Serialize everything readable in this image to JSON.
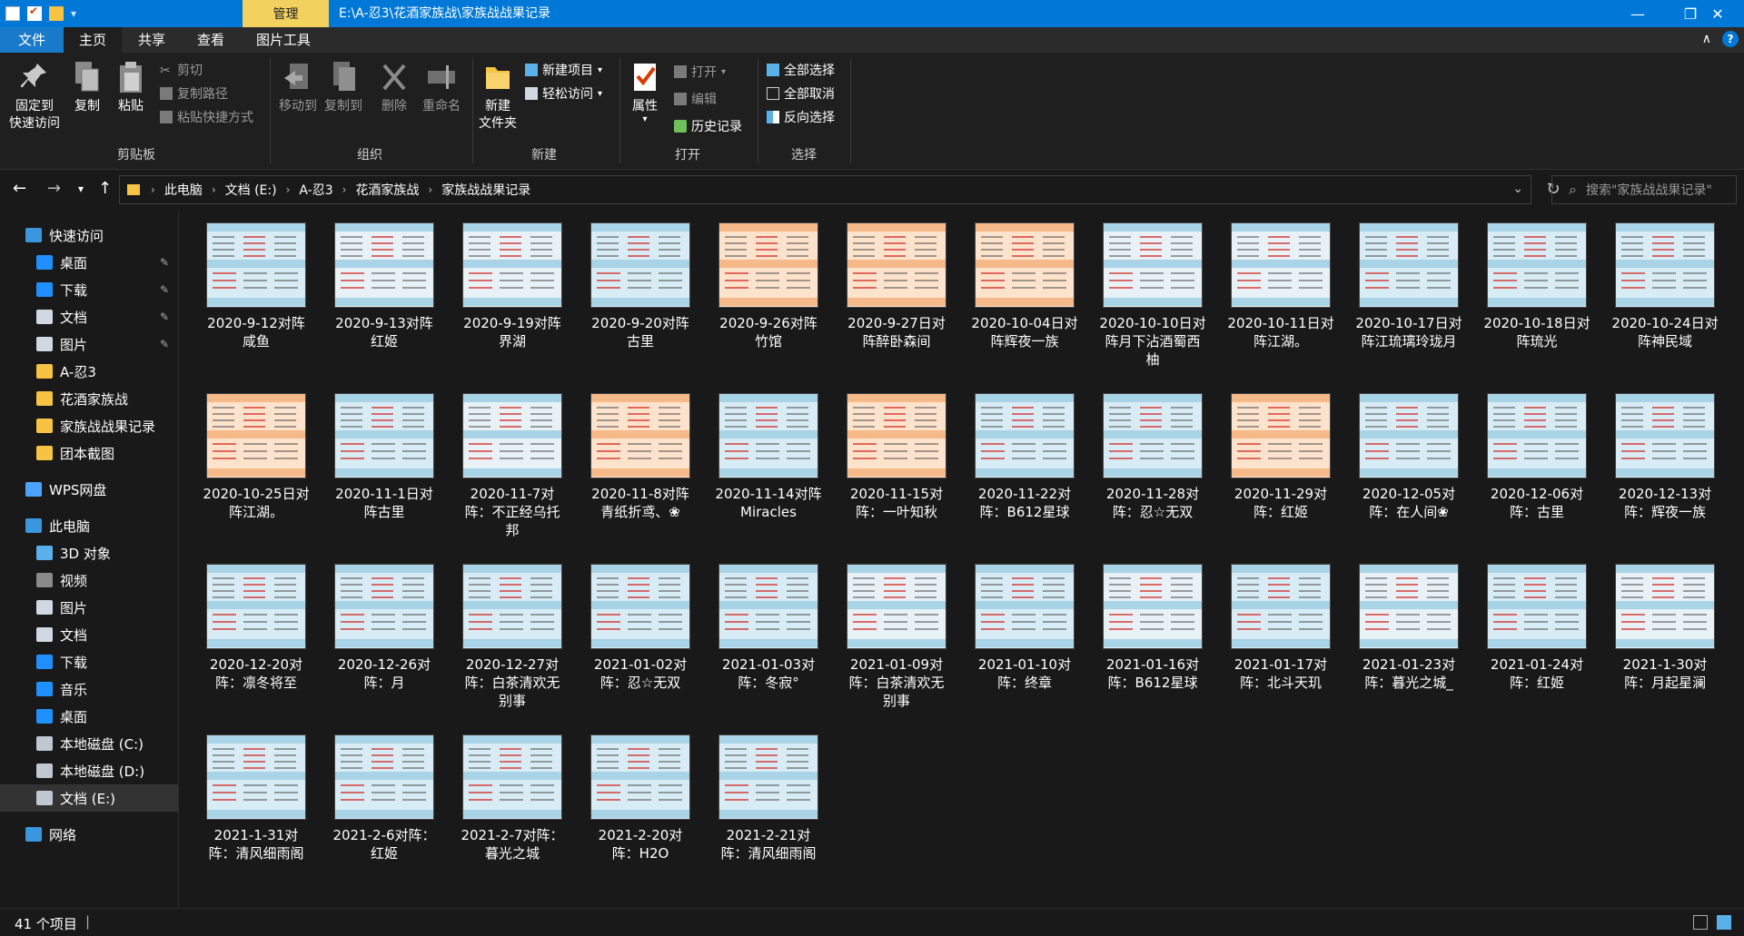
{
  "window": {
    "title": "E:\\A-忍3\\花酒家族战\\家族战战果记录",
    "context_tab": "管理",
    "minimize": "—",
    "restore": "❐",
    "close": "✕"
  },
  "tabs": [
    {
      "label": "文件"
    },
    {
      "label": "主页"
    },
    {
      "label": "共享"
    },
    {
      "label": "查看"
    },
    {
      "label": "图片工具"
    }
  ],
  "ribbon": {
    "clipboard": {
      "group": "剪贴板",
      "pin_l1": "固定到",
      "pin_l2": "快速访问",
      "copy": "复制",
      "paste": "粘贴",
      "cut": "剪切",
      "copy_path": "复制路径",
      "paste_shortcut": "粘贴快捷方式"
    },
    "organize": {
      "group": "组织",
      "move_to": "移动到",
      "copy_to": "复制到",
      "delete": "删除",
      "rename": "重命名"
    },
    "new": {
      "group": "新建",
      "new_folder_l1": "新建",
      "new_folder_l2": "文件夹",
      "new_item": "新建项目",
      "easy_access": "轻松访问"
    },
    "open": {
      "group": "打开",
      "properties": "属性",
      "open": "打开",
      "edit": "编辑",
      "history": "历史记录"
    },
    "select": {
      "group": "选择",
      "select_all": "全部选择",
      "select_none": "全部取消",
      "invert": "反向选择"
    }
  },
  "address": {
    "crumbs": [
      "此电脑",
      "文档 (E:)",
      "A-忍3",
      "花酒家族战",
      "家族战战果记录"
    ],
    "search_placeholder": "搜索\"家族战战果记录\""
  },
  "sidebar": [
    {
      "label": "快速访问",
      "icon": "star-icon",
      "color": "#3a96dd",
      "pinned": false,
      "indent": 0
    },
    {
      "label": "桌面",
      "icon": "desktop-icon",
      "color": "#1e90ff",
      "pinned": true,
      "indent": 1
    },
    {
      "label": "下载",
      "icon": "download-icon",
      "color": "#1e90ff",
      "pinned": true,
      "indent": 1
    },
    {
      "label": "文档",
      "icon": "document-icon",
      "color": "#cfd8e3",
      "pinned": true,
      "indent": 1
    },
    {
      "label": "图片",
      "icon": "pictures-icon",
      "color": "#cfd8e3",
      "pinned": true,
      "indent": 1
    },
    {
      "label": "A-忍3",
      "icon": "folder-icon",
      "color": "#f6c342",
      "pinned": false,
      "indent": 1
    },
    {
      "label": "花酒家族战",
      "icon": "folder-icon",
      "color": "#f6c342",
      "pinned": false,
      "indent": 1
    },
    {
      "label": "家族战战果记录",
      "icon": "folder-icon",
      "color": "#f6c342",
      "pinned": false,
      "indent": 1
    },
    {
      "label": "团本截图",
      "icon": "folder-icon",
      "color": "#f6c342",
      "pinned": false,
      "indent": 1
    },
    {
      "label": "WPS网盘",
      "icon": "cloud-icon",
      "color": "#4aa3ff",
      "pinned": false,
      "indent": 0
    },
    {
      "label": "此电脑",
      "icon": "computer-icon",
      "color": "#3a96dd",
      "pinned": false,
      "indent": 0
    },
    {
      "label": "3D 对象",
      "icon": "3d-objects-icon",
      "color": "#5ab0e8",
      "pinned": false,
      "indent": 1
    },
    {
      "label": "视频",
      "icon": "video-icon",
      "color": "#8a8a8a",
      "pinned": false,
      "indent": 1
    },
    {
      "label": "图片",
      "icon": "pictures-icon",
      "color": "#cfd8e3",
      "pinned": false,
      "indent": 1
    },
    {
      "label": "文档",
      "icon": "document-icon",
      "color": "#cfd8e3",
      "pinned": false,
      "indent": 1
    },
    {
      "label": "下载",
      "icon": "download-icon",
      "color": "#1e90ff",
      "pinned": false,
      "indent": 1
    },
    {
      "label": "音乐",
      "icon": "music-icon",
      "color": "#1e90ff",
      "pinned": false,
      "indent": 1
    },
    {
      "label": "桌面",
      "icon": "desktop-icon",
      "color": "#1e90ff",
      "pinned": false,
      "indent": 1
    },
    {
      "label": "本地磁盘 (C:)",
      "icon": "drive-c-icon",
      "color": "#bfc7d0",
      "pinned": false,
      "indent": 1
    },
    {
      "label": "本地磁盘 (D:)",
      "icon": "drive-icon",
      "color": "#bfc7d0",
      "pinned": false,
      "indent": 1
    },
    {
      "label": "文档 (E:)",
      "icon": "drive-icon",
      "color": "#bfc7d0",
      "pinned": false,
      "indent": 1,
      "selected": true
    },
    {
      "label": "网络",
      "icon": "network-icon",
      "color": "#3a96dd",
      "pinned": false,
      "indent": 0
    }
  ],
  "files": [
    {
      "line1": "2020-9-12对阵",
      "line2": "咸鱼",
      "tone": "blue"
    },
    {
      "line1": "2020-9-13对阵",
      "line2": "红姬",
      "tone": "white"
    },
    {
      "line1": "2020-9-19对阵",
      "line2": "界湖",
      "tone": "white"
    },
    {
      "line1": "2020-9-20对阵",
      "line2": "古里",
      "tone": "blue"
    },
    {
      "line1": "2020-9-26对阵",
      "line2": "竹馆",
      "tone": "orange"
    },
    {
      "line1": "2020-9-27日对",
      "line2": "阵醉卧森间",
      "tone": "orange"
    },
    {
      "line1": "2020-10-04日对",
      "line2": "阵辉夜一族",
      "tone": "orange"
    },
    {
      "line1": "2020-10-10日对",
      "line2": "阵月下沾酒蜀西",
      "line3": "柚",
      "tone": "white"
    },
    {
      "line1": "2020-10-11日对",
      "line2": "阵江湖。",
      "tone": "white"
    },
    {
      "line1": "2020-10-17日对",
      "line2": "阵江琉璃玲珑月",
      "tone": "blue"
    },
    {
      "line1": "2020-10-18日对",
      "line2": "阵琉光",
      "tone": "blue"
    },
    {
      "line1": "2020-10-24日对",
      "line2": "阵神民域",
      "tone": "blue"
    },
    {
      "line1": "2020-10-25日对",
      "line2": "阵江湖。",
      "tone": "orange"
    },
    {
      "line1": "2020-11-1日对",
      "line2": "阵古里",
      "tone": "blue"
    },
    {
      "line1": "2020-11-7对",
      "line2": "阵：不正经乌托",
      "line3": "邦",
      "tone": "white"
    },
    {
      "line1": "2020-11-8对阵",
      "line2": "青纸折鸢、❀",
      "tone": "orange"
    },
    {
      "line1": "2020-11-14对阵",
      "line2": "Miracles",
      "tone": "blue"
    },
    {
      "line1": "2020-11-15对",
      "line2": "阵：一叶知秋",
      "tone": "orange"
    },
    {
      "line1": "2020-11-22对",
      "line2": "阵：B612星球",
      "tone": "blue"
    },
    {
      "line1": "2020-11-28对",
      "line2": "阵：忍☆无双",
      "tone": "blue"
    },
    {
      "line1": "2020-11-29对",
      "line2": "阵：红姬",
      "tone": "orange"
    },
    {
      "line1": "2020-12-05对",
      "line2": "阵：在人间❀",
      "tone": "blue"
    },
    {
      "line1": "2020-12-06对",
      "line2": "阵：古里",
      "tone": "blue"
    },
    {
      "line1": "2020-12-13对",
      "line2": "阵：辉夜一族",
      "tone": "blue"
    },
    {
      "line1": "2020-12-20对",
      "line2": "阵：凛冬将至",
      "tone": "blue"
    },
    {
      "line1": "2020-12-26对",
      "line2": "阵：月",
      "tone": "blue"
    },
    {
      "line1": "2020-12-27对",
      "line2": "阵：白茶清欢无",
      "line3": "别事",
      "tone": "blue"
    },
    {
      "line1": "2021-01-02对",
      "line2": "阵：忍☆无双",
      "tone": "blue"
    },
    {
      "line1": "2021-01-03对",
      "line2": "阵：冬寂°",
      "tone": "blue"
    },
    {
      "line1": "2021-01-09对",
      "line2": "阵：白茶清欢无",
      "line3": "别事",
      "tone": "white"
    },
    {
      "line1": "2021-01-10对",
      "line2": "阵：终章",
      "tone": "blue"
    },
    {
      "line1": "2021-01-16对",
      "line2": "阵：B612星球",
      "tone": "white"
    },
    {
      "line1": "2021-01-17对",
      "line2": "阵：北斗天玑",
      "tone": "blue"
    },
    {
      "line1": "2021-01-23对",
      "line2": "阵：暮光之城_",
      "tone": "white"
    },
    {
      "line1": "2021-01-24对",
      "line2": "阵：红姬",
      "tone": "blue"
    },
    {
      "line1": "2021-1-30对",
      "line2": "阵：月起星澜",
      "tone": "white"
    },
    {
      "line1": "2021-1-31对",
      "line2": "阵：清风细雨阁",
      "tone": "blue"
    },
    {
      "line1": "2021-2-6对阵：",
      "line2": "红姬",
      "tone": "blue"
    },
    {
      "line1": "2021-2-7对阵：",
      "line2": "暮光之城",
      "tone": "blue"
    },
    {
      "line1": "2021-2-20对",
      "line2": "阵：H2O",
      "tone": "blue"
    },
    {
      "line1": "2021-2-21对",
      "line2": "阵：清风细雨阁",
      "tone": "blue"
    }
  ],
  "status": {
    "item_count": "41 个项目"
  }
}
